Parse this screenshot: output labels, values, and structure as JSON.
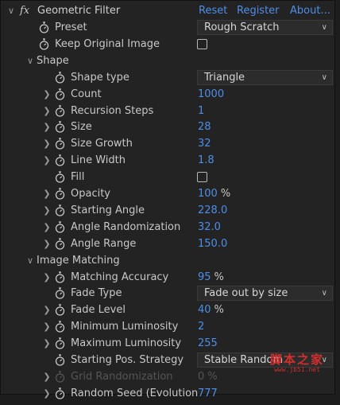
{
  "header": {
    "fx": "fx",
    "title": "Geometric Filter",
    "links": [
      "Reset",
      "Register",
      "About..."
    ]
  },
  "rows": [
    {
      "label": "Preset",
      "type": "dropdown",
      "value": "Rough Scratch"
    },
    {
      "label": "Keep Original Image",
      "type": "checkbox",
      "checked": false
    },
    {
      "label": "Shape",
      "type": "section"
    },
    {
      "label": "Shape type",
      "type": "dropdown",
      "value": "Triangle"
    },
    {
      "label": "Count",
      "type": "number",
      "value": "1000"
    },
    {
      "label": "Recursion Steps",
      "type": "number",
      "value": "1"
    },
    {
      "label": "Size",
      "type": "number",
      "value": "28"
    },
    {
      "label": "Size Growth",
      "type": "number",
      "value": "32"
    },
    {
      "label": "Line Width",
      "type": "number",
      "value": "1.8"
    },
    {
      "label": "Fill",
      "type": "checkbox",
      "checked": false
    },
    {
      "label": "Opacity",
      "type": "number",
      "value": "100",
      "unit": "%"
    },
    {
      "label": "Starting Angle",
      "type": "number",
      "value": "228.0"
    },
    {
      "label": "Angle Randomization",
      "type": "number",
      "value": "32.0"
    },
    {
      "label": "Angle Range",
      "type": "number",
      "value": "150.0"
    },
    {
      "label": "Image Matching",
      "type": "section"
    },
    {
      "label": "Matching Accuracy",
      "type": "number",
      "value": "95",
      "unit": "%"
    },
    {
      "label": "Fade Type",
      "type": "dropdown",
      "value": "Fade out by size"
    },
    {
      "label": "Fade Level",
      "type": "number",
      "value": "40",
      "unit": "%"
    },
    {
      "label": "Minimum Luminosity",
      "type": "number",
      "value": "2"
    },
    {
      "label": "Maximum Luminosity",
      "type": "number",
      "value": "255"
    },
    {
      "label": "Starting Pos. Strategy",
      "type": "dropdown",
      "value": "Stable Random"
    },
    {
      "label": "Grid Randomization",
      "type": "number",
      "value": "0",
      "unit": "%",
      "disabled": true
    },
    {
      "label": "Random Seed (Evolution",
      "type": "number",
      "value": "777"
    }
  ],
  "watermark": {
    "main": "脚本之家",
    "sub": "www.jb51.net"
  },
  "colors": {
    "accent": "#4e8ee8",
    "panel": "#232323",
    "text": "#c8c8c8"
  }
}
